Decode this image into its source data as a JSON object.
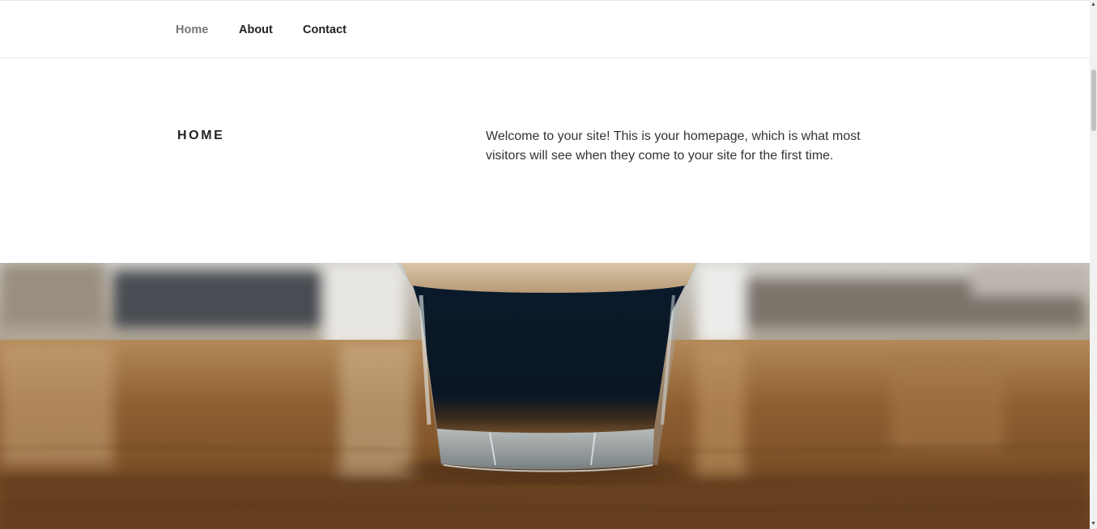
{
  "nav": {
    "items": [
      {
        "label": "Home"
      },
      {
        "label": "About"
      },
      {
        "label": "Contact"
      }
    ]
  },
  "panel": {
    "title": "HOME",
    "text": "Welcome to your site! This is your homepage, which is what most visitors will see when they come to your site for the first time."
  },
  "hero": {
    "subject": "espresso glass on wooden table"
  },
  "colors": {
    "text": "#222222",
    "muted_nav": "#767676",
    "wood": "#8a5a2c",
    "coffee": "#0d1d2e"
  }
}
